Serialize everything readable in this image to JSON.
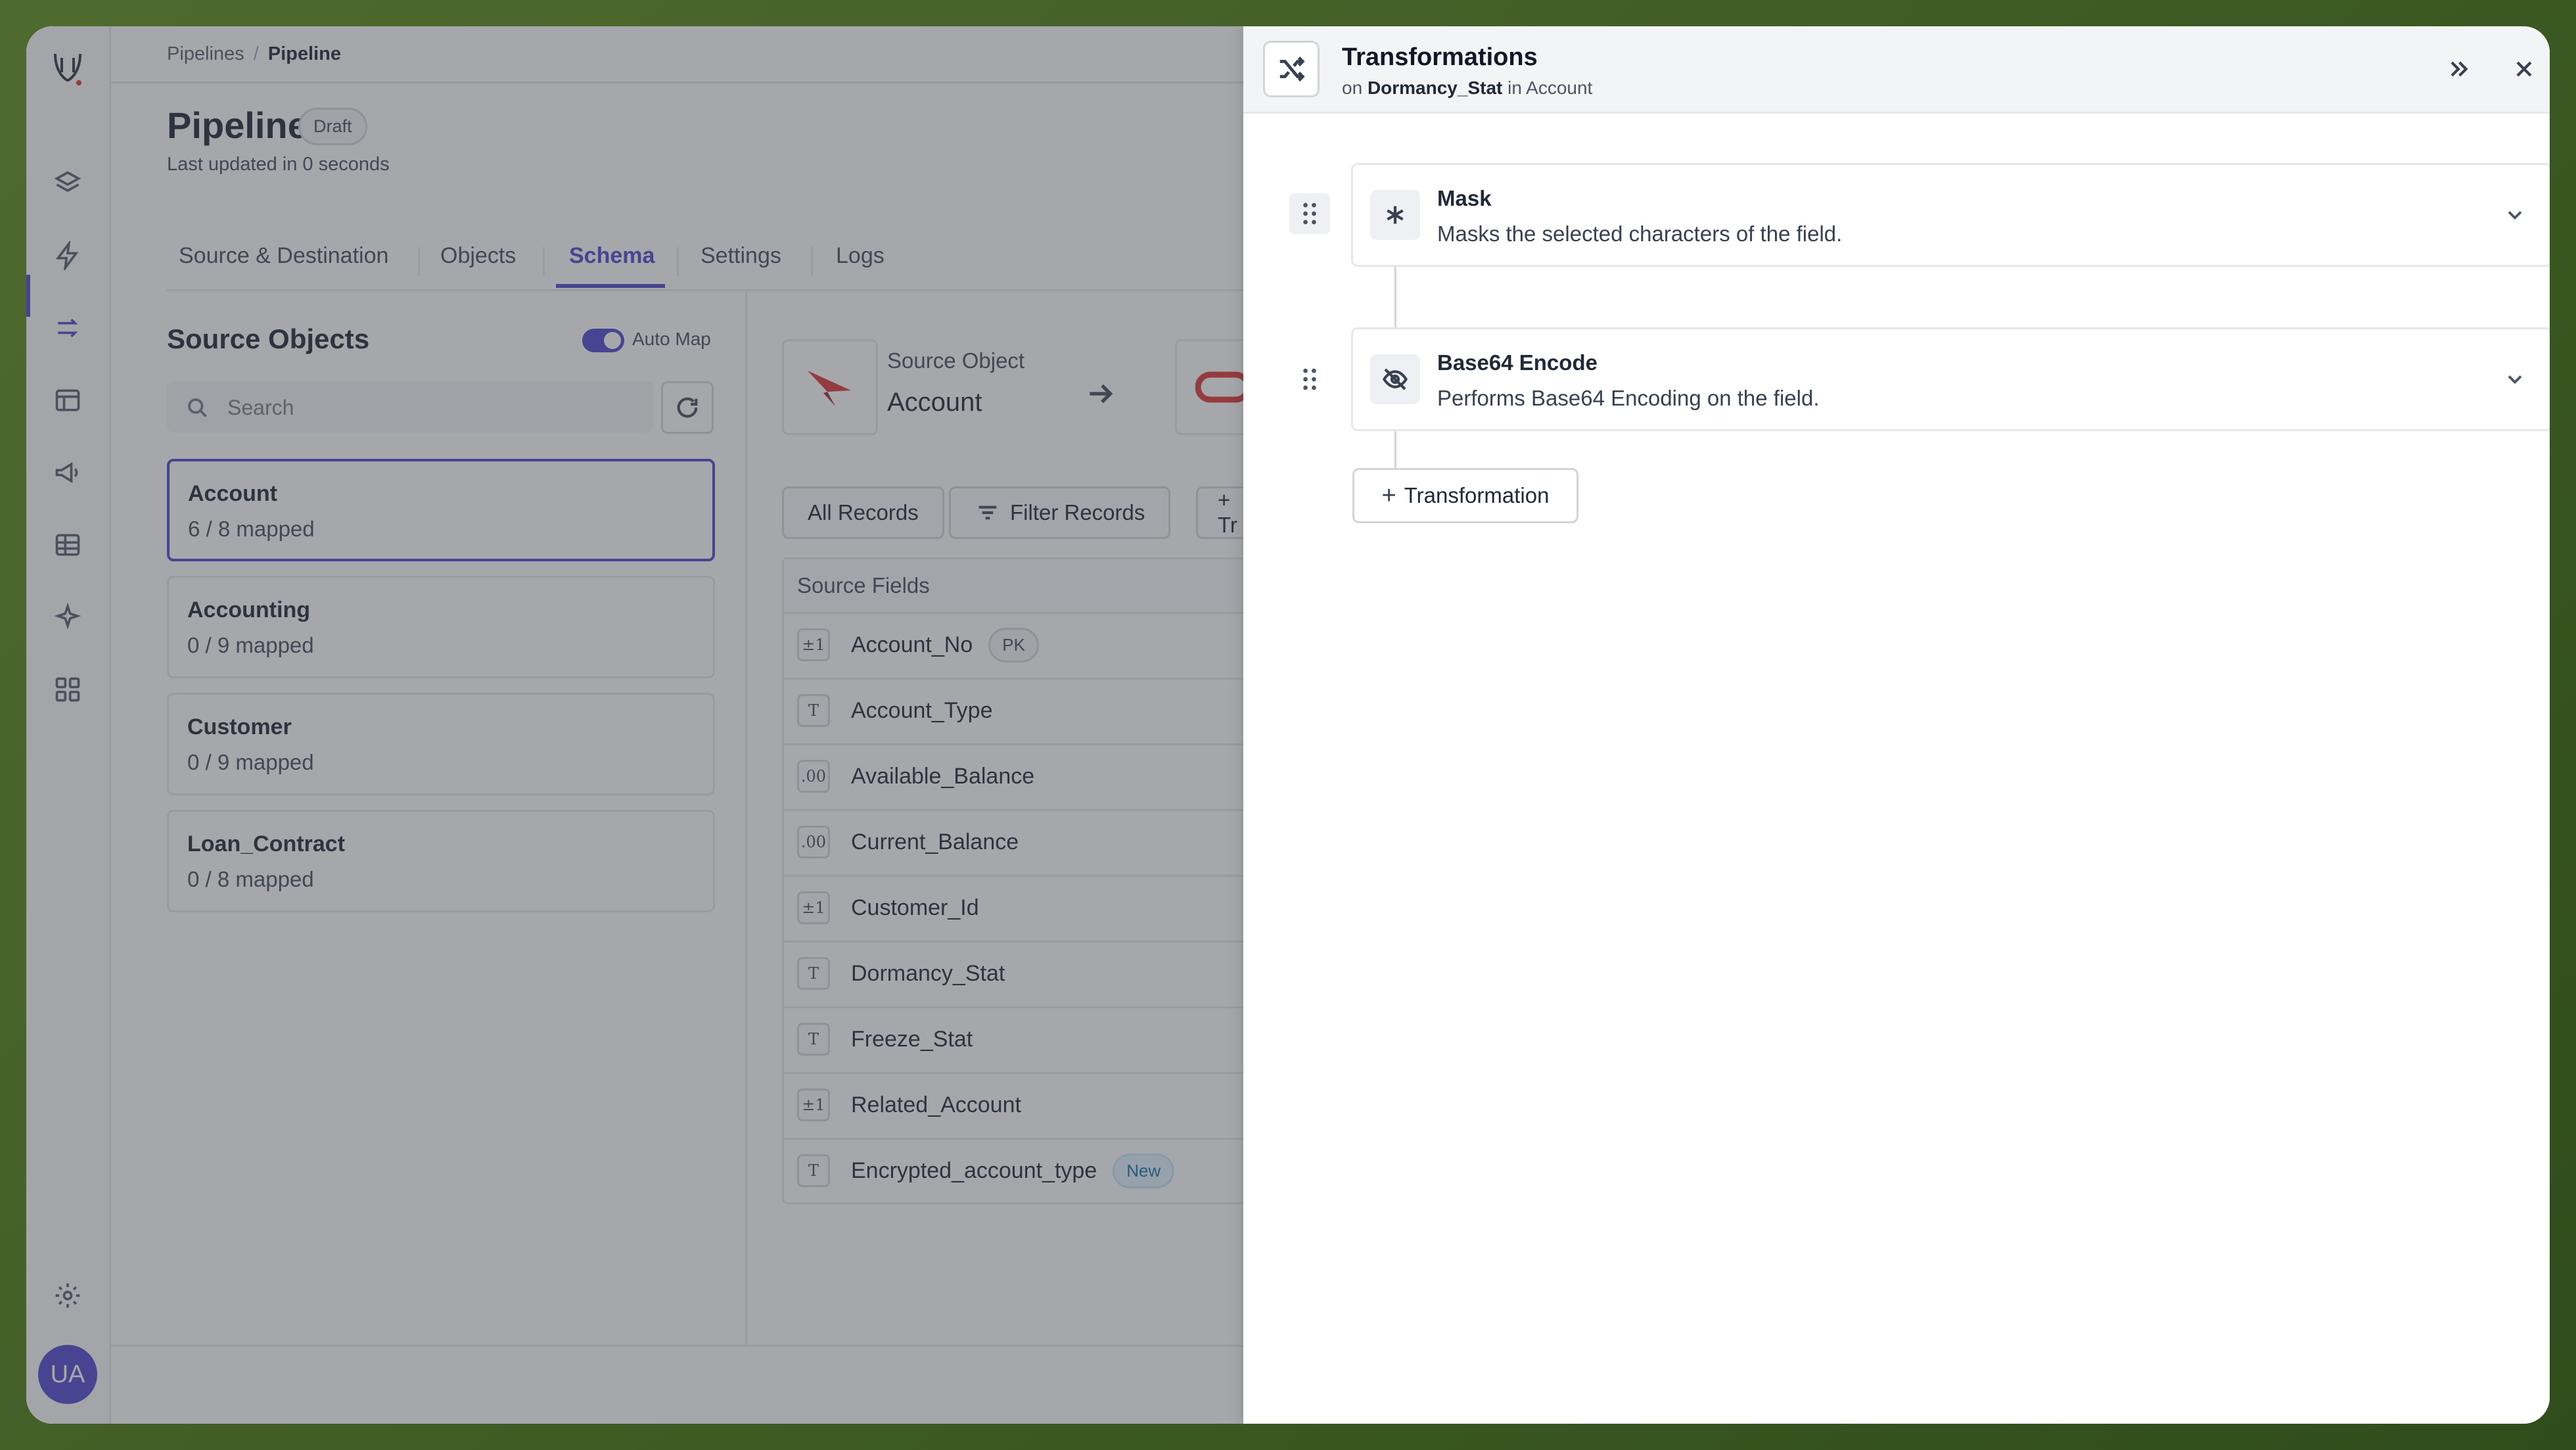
{
  "breadcrumb": {
    "parent": "Pipelines",
    "separator": "/",
    "current": "Pipeline"
  },
  "page": {
    "title": "Pipeline",
    "status_badge": "Draft",
    "last_updated": "Last updated in 0 seconds"
  },
  "tabs": [
    {
      "label": "Source & Destination"
    },
    {
      "label": "Objects"
    },
    {
      "label": "Schema",
      "active": true
    },
    {
      "label": "Settings"
    },
    {
      "label": "Logs"
    }
  ],
  "source_objects": {
    "title": "Source Objects",
    "auto_map_label": "Auto Map",
    "auto_map_on": true,
    "search_placeholder": "Search",
    "items": [
      {
        "name": "Account",
        "mapped": "6 / 8 mapped",
        "selected": true
      },
      {
        "name": "Accounting",
        "mapped": "0 / 9 mapped"
      },
      {
        "name": "Customer",
        "mapped": "0 / 9 mapped"
      },
      {
        "name": "Loan_Contract",
        "mapped": "0 / 8 mapped"
      }
    ]
  },
  "source_object": {
    "label": "Source Object",
    "value": "Account"
  },
  "records": {
    "all": "All Records",
    "filter": "Filter Records",
    "transform_partial": "+ Tr"
  },
  "source_fields": {
    "header": "Source Fields",
    "rows": [
      {
        "type": "±1",
        "name": "Account_No",
        "badge": "PK"
      },
      {
        "type": "T",
        "name": "Account_Type"
      },
      {
        "type": ".00",
        "name": "Available_Balance"
      },
      {
        "type": ".00",
        "name": "Current_Balance"
      },
      {
        "type": "±1",
        "name": "Customer_Id"
      },
      {
        "type": "T",
        "name": "Dormancy_Stat"
      },
      {
        "type": "T",
        "name": "Freeze_Stat"
      },
      {
        "type": "±1",
        "name": "Related_Account"
      },
      {
        "type": "T",
        "name": "Encrypted_account_type",
        "badge": "New"
      }
    ]
  },
  "user": {
    "initials": "UA"
  },
  "drawer": {
    "title": "Transformations",
    "subtitle_prefix": "on",
    "field": "Dormancy_Stat",
    "subtitle_in": "in",
    "object": "Account",
    "transformations": [
      {
        "name": "Mask",
        "description": "Masks the selected characters of the field.",
        "icon": "asterisk-icon"
      },
      {
        "name": "Base64 Encode",
        "description": "Performs Base64 Encoding on the field.",
        "icon": "eye-off-icon"
      }
    ],
    "add_button": "Transformation"
  },
  "colors": {
    "accent": "#4338ca",
    "background": "#4f6a2e"
  }
}
